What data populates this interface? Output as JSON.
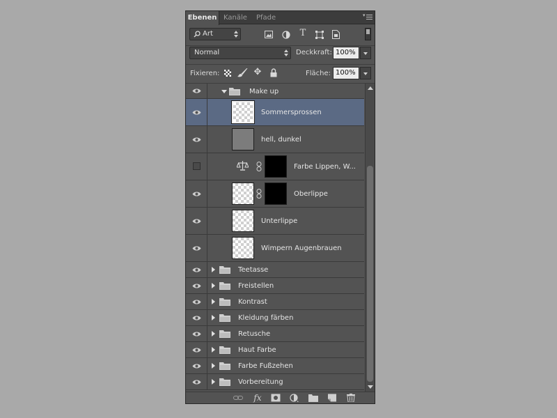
{
  "tabs": [
    {
      "label": "Ebenen",
      "active": true
    },
    {
      "label": "Kanäle",
      "active": false
    },
    {
      "label": "Pfade",
      "active": false
    }
  ],
  "filter": {
    "kind_label": "Art"
  },
  "blend": {
    "mode": "Normal",
    "opacity_label": "Deckkraft:",
    "opacity_value": "100%"
  },
  "lock": {
    "label": "Fixieren:",
    "fill_label": "Fläche:",
    "fill_value": "100%"
  },
  "layers": {
    "group_open": "Make up",
    "l1": "Sommersprossen",
    "l2": "hell, dunkel",
    "l3": "Farbe Lippen, W...",
    "l4": "Oberlippe",
    "l5": "Unterlippe",
    "l6": "Wimpern Augenbrauen",
    "g1": "Teetasse",
    "g2": "Freistellen",
    "g3": "Kontrast",
    "g4": "Kleidung färben",
    "g5": "Retusche",
    "g6": "Haut Farbe",
    "g7": "Farbe Fußzehen",
    "g8": "Vorbereitung"
  },
  "bottom": {
    "fx_label": "fx"
  },
  "colors": {
    "panel": "#535353",
    "selected": "#5b6a84",
    "background": "#a9a9a9"
  }
}
